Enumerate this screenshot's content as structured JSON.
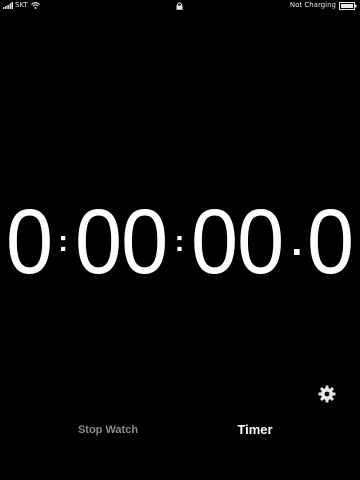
{
  "status_bar": {
    "carrier": "SKT",
    "charging_text": "Not Charging",
    "icons": [
      "signal-icon",
      "wifi-icon",
      "lock-icon",
      "battery-icon"
    ]
  },
  "display": {
    "hours": "0",
    "minutes": "00",
    "seconds": "00",
    "tenths": "0",
    "separator": ":",
    "decimal": "."
  },
  "tabs": {
    "stopwatch_label": "Stop Watch",
    "timer_label": "Timer",
    "active": "Timer"
  },
  "colors": {
    "background": "#000000",
    "text": "#ffffff",
    "inactive_tab": "#8a8a8a"
  },
  "settings": {
    "icon": "gear-icon"
  }
}
